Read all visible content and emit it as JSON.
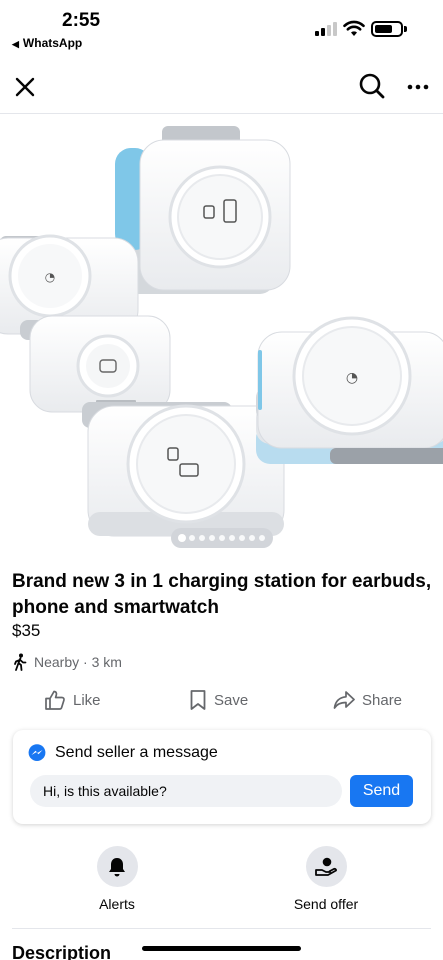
{
  "status_bar": {
    "time": "2:55",
    "back_app": "WhatsApp",
    "signal_bars_filled": 2,
    "signal_bars_total": 4,
    "battery_level": 0.7
  },
  "nav": {
    "close_icon": "close-icon",
    "search_icon": "search-icon",
    "more_icon": "more-horizontal-icon"
  },
  "product": {
    "image_description": "white foldable 3-in-1 wireless charging station",
    "carousel_count": 9,
    "carousel_active_index": 0,
    "title": "Brand new 3 in 1 charging station for earbuds, phone and smartwatch",
    "price": "$35",
    "location": "Nearby · 3 km"
  },
  "actions": {
    "like": "Like",
    "save": "Save",
    "share": "Share"
  },
  "message": {
    "heading": "Send seller a message",
    "input_value": "Hi, is this available?",
    "send_label": "Send"
  },
  "tools": {
    "alerts": "Alerts",
    "send_offer": "Send offer"
  },
  "description_heading": "Description",
  "colors": {
    "accent": "#1877f2",
    "secondary_text": "#65676b",
    "input_bg": "#f0f2f5",
    "circle_bg": "#e4e6eb"
  }
}
